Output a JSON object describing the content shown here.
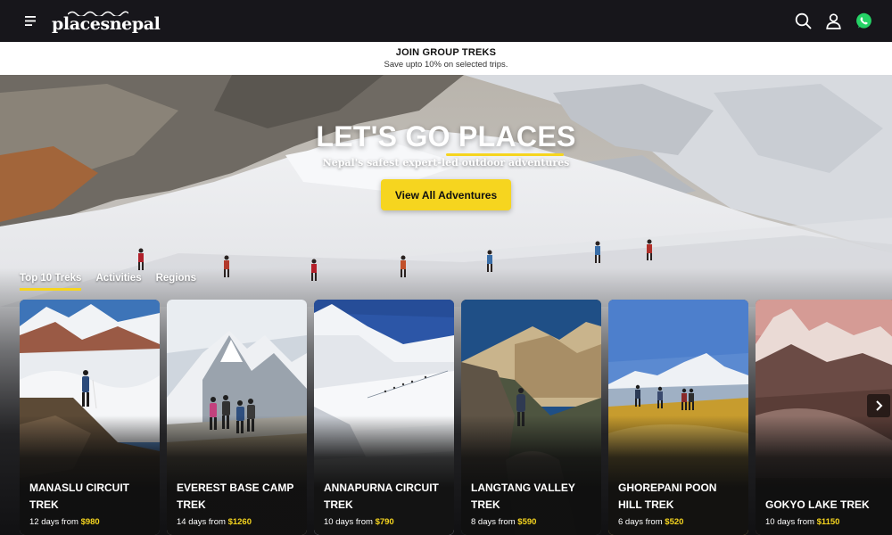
{
  "nav": {
    "logo_text": "placesnepal",
    "icons": [
      "menu-icon",
      "search-icon",
      "user-icon",
      "whatsapp-icon"
    ],
    "whatsapp_color": "#25d366"
  },
  "promo": {
    "title": "JOIN GROUP TREKS",
    "subtitle": "Save upto 10% on selected trips."
  },
  "hero": {
    "title": "LET'S GO PLACES",
    "subtitle": "Nepal's safest expert-led outdoor adventures",
    "cta_label": "View All Adventures"
  },
  "tabs": [
    {
      "label": "Top 10 Treks",
      "active": true
    },
    {
      "label": "Activities",
      "active": false
    },
    {
      "label": "Regions",
      "active": false
    }
  ],
  "cards": [
    {
      "title": "MANASLU CIRCUIT TREK",
      "duration": "12 days from",
      "price": "$980"
    },
    {
      "title": "EVEREST BASE CAMP TREK",
      "duration": "14 days from",
      "price": "$1260"
    },
    {
      "title": "ANNAPURNA CIRCUIT TREK",
      "duration": "10 days from",
      "price": "$790"
    },
    {
      "title": "LANGTANG VALLEY TREK",
      "duration": "8 days from",
      "price": "$590"
    },
    {
      "title": "GHOREPANI POON HILL TREK",
      "duration": "6 days from",
      "price": "$520"
    },
    {
      "title": "GOKYO LAKE TREK",
      "duration": "10 days from",
      "price": "$1150"
    }
  ],
  "colors": {
    "accent": "#f6d51f",
    "nav_bg": "#17161b",
    "page_bg": "#111113"
  }
}
